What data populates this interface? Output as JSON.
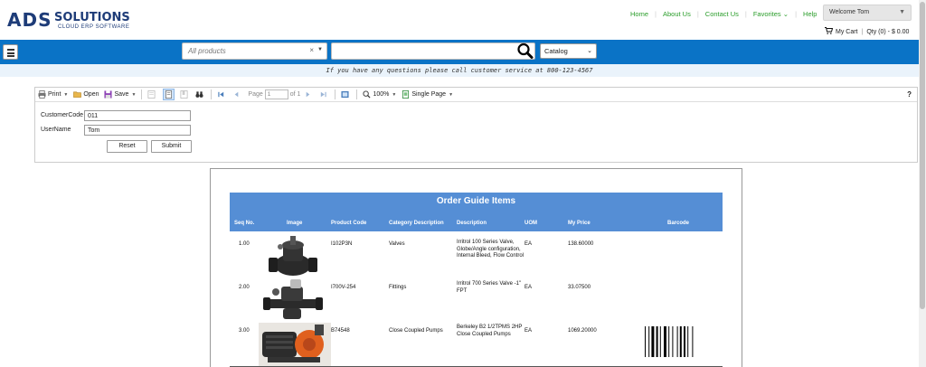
{
  "header": {
    "logo_main": "ADS",
    "logo_solutions": "SOLUTIONS",
    "logo_tagline": "CLOUD ERP SOFTWARE",
    "links": [
      "Home",
      "About Us",
      "Contact Us",
      "Favorites",
      "Help"
    ],
    "welcome": "Welcome Tom",
    "cart_label": "My Cart",
    "cart_qty": "Qty (0) - $ 0.00"
  },
  "search": {
    "category_placeholder": "All products",
    "input_value": "",
    "scope": "Catalog"
  },
  "notice": "If you have any questions please call customer service at 800-123-4567",
  "toolbar": {
    "print": "Print",
    "open": "Open",
    "save": "Save",
    "page_label": "Page",
    "page_value": "1",
    "page_of": "of 1",
    "zoom": "100%",
    "view": "Single Page",
    "help": "?"
  },
  "params": {
    "customer_code_label": "CustomerCode",
    "customer_code_value": "011",
    "user_name_label": "UserName",
    "user_name_value": "Tom",
    "reset": "Reset",
    "submit": "Submit"
  },
  "report": {
    "title": "Order Guide Items",
    "columns": [
      "Seq No.",
      "Image",
      "Product Code",
      "Category Description",
      "Description",
      "UOM",
      "My Price",
      "Barcode"
    ],
    "rows": [
      {
        "seq": "1.00",
        "code": "I102P3N",
        "category": "Valves",
        "desc": [
          "Irritrol 100 Series Valve,",
          "Globe/Angle configuration,",
          "Internal Bleed, Flow Control"
        ],
        "uom": "EA",
        "price": "138.60000"
      },
      {
        "seq": "2.00",
        "code": "I700V-254",
        "category": "Fittings",
        "desc": [
          "Irritrol 700 Series Valve -1\"",
          "FPT"
        ],
        "uom": "EA",
        "price": "33.07500"
      },
      {
        "seq": "3.00",
        "code": "B74548",
        "category": "Close Coupled Pumps",
        "desc": [
          "Berkeley B2 1/2TPMS 2HP",
          "Close Coupled Pumps"
        ],
        "uom": "EA",
        "price": "1069.20000"
      }
    ]
  },
  "colors": {
    "brand_blue": "#0a73c6",
    "report_header": "#558ed5",
    "link_green": "#2a9d2a"
  }
}
